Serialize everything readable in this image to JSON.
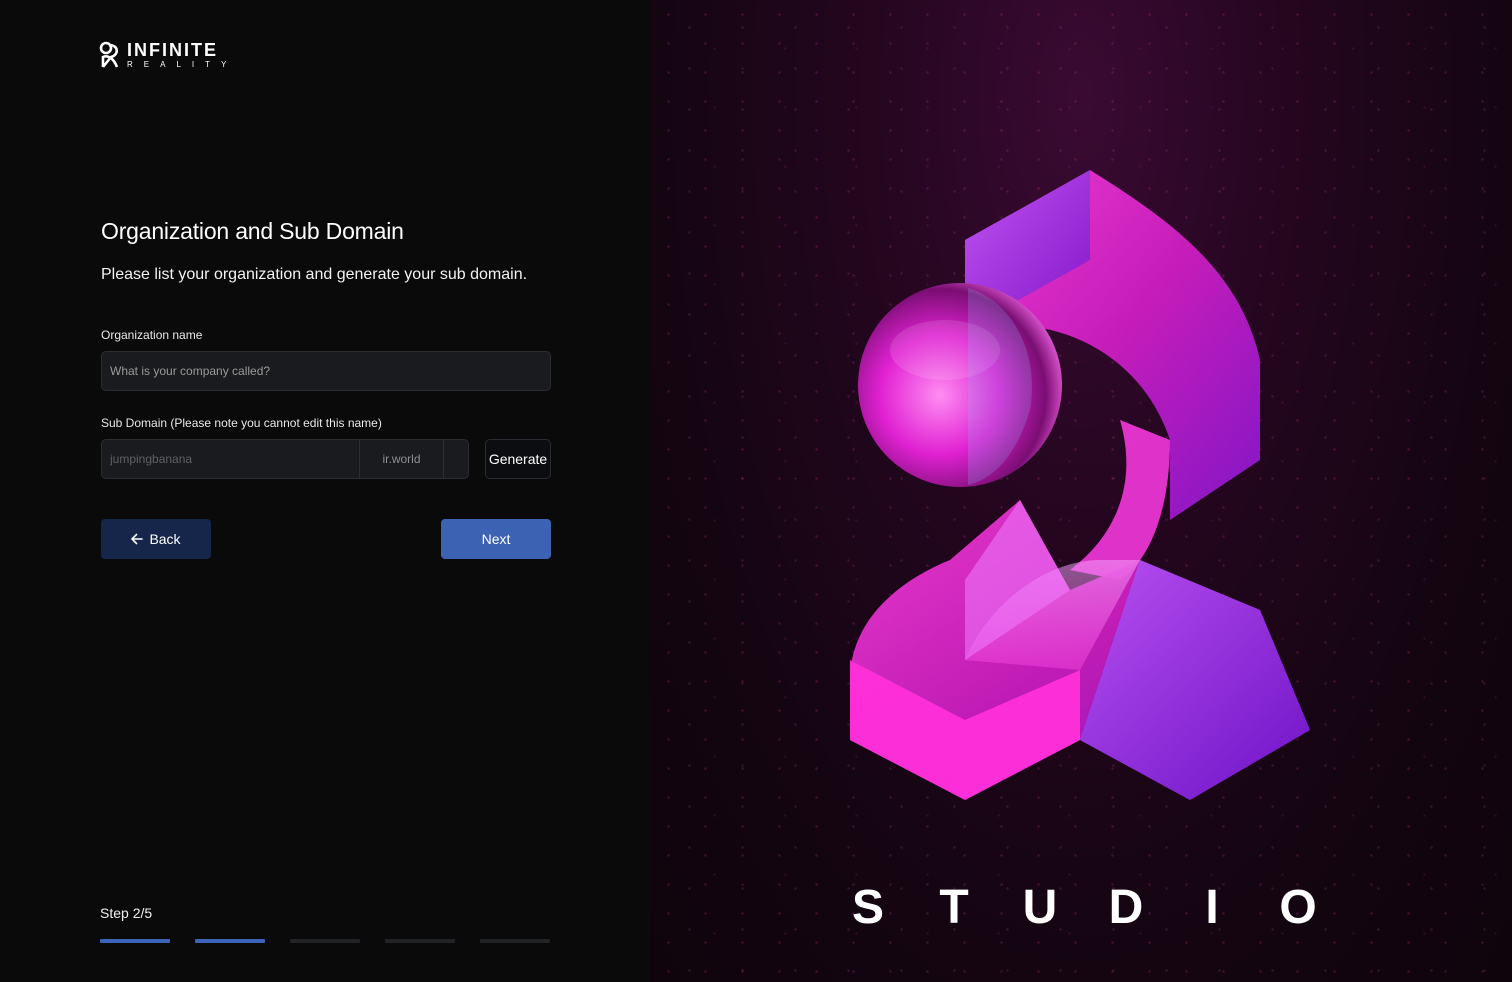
{
  "brand": {
    "name": "INFINITE",
    "sub": "REALITY"
  },
  "form": {
    "title": "Organization and Sub Domain",
    "subtitle": "Please list your organization and generate your sub domain.",
    "org_label": "Organization name",
    "org_placeholder": "What is your company called?",
    "org_value": "",
    "sub_label": "Sub Domain (Please note you cannot edit this name)",
    "sub_placeholder": "jumpingbanana",
    "sub_value": "",
    "sub_suffix": "ir.world",
    "generate_label": "Generate",
    "back_label": "Back",
    "next_label": "Next"
  },
  "progress": {
    "step_label": "Step 2/5",
    "current": 2,
    "total": 5
  },
  "hero": {
    "letters": [
      "S",
      "T",
      "U",
      "D",
      "I",
      "O"
    ]
  },
  "colors": {
    "accent": "#3b62b3",
    "back_button": "#15264a",
    "progress_active": "#3d64b8",
    "progress_inactive": "#222327",
    "hero_magenta": "#e62bd6"
  },
  "icons": {
    "logo": "infinite-reality-logo-icon",
    "back": "arrow-left-icon"
  }
}
